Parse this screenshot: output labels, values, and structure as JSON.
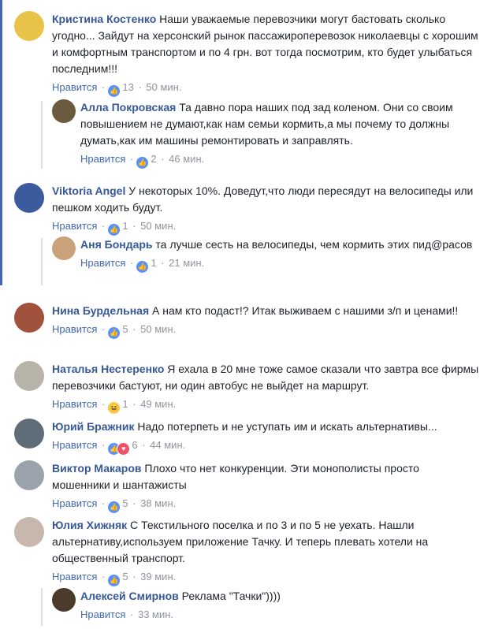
{
  "labels": {
    "like": "Нравится",
    "dot": "·"
  },
  "comments": [
    {
      "author": "Кристина Костенко",
      "text": "Наши уважаемые перевозчики могут бастовать сколько угодно... Зайдут на херсонский рынок пассажироперевозок николаевцы с хорошим и комфортным транспортом и по 4 грн. вот тогда посмотрим, кто будет улыбаться последним!!!",
      "count": "13",
      "time": "50 мин.",
      "reaction": "thumb",
      "avatar_color": "#e8c34a"
    },
    {
      "author": "Алла Покровская",
      "text": "Та давно пора наших под зад коленом. Они со своим повышением не думают,как нам семьи кормить,а мы почему то должны думать,как им машины ремонтировать и заправлять.",
      "count": "2",
      "time": "46 мин.",
      "reaction": "thumb",
      "avatar_color": "#6b5a3e"
    },
    {
      "author": "Viktoria Angel",
      "text": "У некоторых 10%. Доведут,что люди пересядут на велосипеды или пешком ходить будут.",
      "count": "1",
      "time": "50 мин.",
      "reaction": "thumb",
      "avatar_color": "#3b5b9e"
    },
    {
      "author": "Аня Бондарь",
      "text": "та лучше сесть на велосипеды, чем кормить этих пид@расов",
      "count": "1",
      "time": "21 мин.",
      "reaction": "thumb",
      "avatar_color": "#c9a27a"
    },
    {
      "author": "Нина Бурдельная",
      "text": "А нам кто подаст!? Итак выживаем с нашими з/п и ценами!!",
      "count": "5",
      "time": "50 мин.",
      "reaction": "thumb",
      "avatar_color": "#a0523d"
    },
    {
      "author": "Наталья Нестеренко",
      "text": "Я ехала в 20 мне тоже самое сказали что завтра все фирмы перевозчики бастуют, ни один автобус не выйдет на маршрут.",
      "count": "1",
      "time": "49 мин.",
      "reaction": "haha",
      "avatar_color": "#b8b3a8"
    },
    {
      "author": "Юрий Бражник",
      "text": "Надо потерпеть и не уступать им и искать альтернативы...",
      "count": "6",
      "time": "44 мин.",
      "reaction": "thumb-heart",
      "avatar_color": "#5f6d78"
    },
    {
      "author": "Виктор Макаров",
      "text": "Плохо что нет конкуренции. Эти монополисты просто мошенники и шантажисты",
      "count": "5",
      "time": "38 мин.",
      "reaction": "thumb",
      "avatar_color": "#9aa3ab"
    },
    {
      "author": "Юлия Хижняк",
      "text": "С Текстильного поселка и по 3 и по 5 не уехать. Нашли альтернативу,используем приложение Тачку. И теперь плевать хотели на общественный транспорт.",
      "count": "5",
      "time": "39 мин.",
      "reaction": "thumb",
      "avatar_color": "#c7b7ad"
    },
    {
      "author": "Алексей Смирнов",
      "text": "Реклама \"Тачки\"))))",
      "count": "",
      "time": "33 мин.",
      "reaction": "none",
      "avatar_color": "#4a3b2a"
    }
  ]
}
